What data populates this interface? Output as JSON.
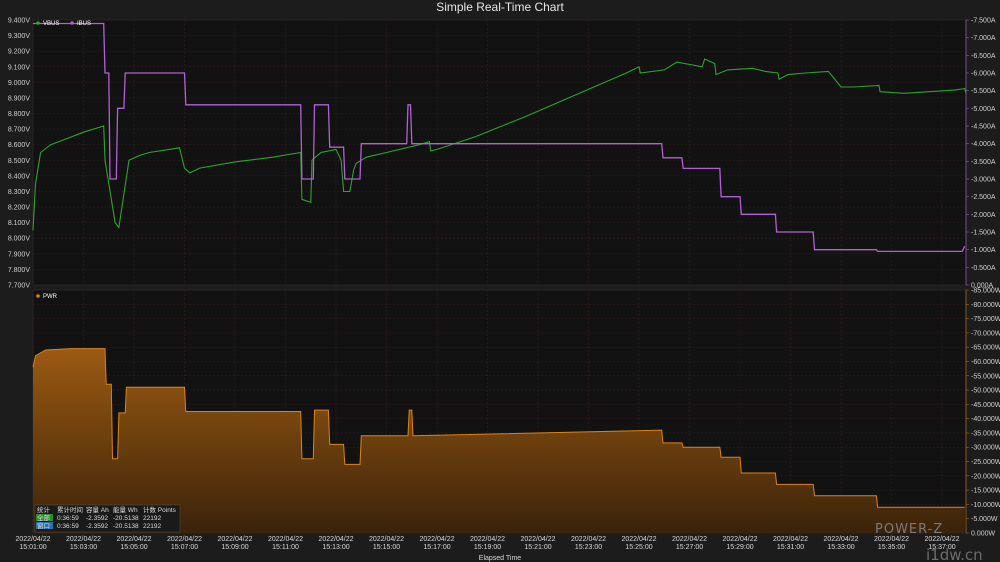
{
  "title": "Simple Real-Time Chart",
  "watermark": "POWER-Z",
  "corner_text": "i1dw.cn",
  "xlabel": "Elapsed Time",
  "x_ticks": [
    [
      "2022/04/22",
      "15:01:00"
    ],
    [
      "2022/04/22",
      "15:03:00"
    ],
    [
      "2022/04/22",
      "15:05:00"
    ],
    [
      "2022/04/22",
      "15:07:00"
    ],
    [
      "2022/04/22",
      "15:09:00"
    ],
    [
      "2022/04/22",
      "15:11:00"
    ],
    [
      "2022/04/22",
      "15:13:00"
    ],
    [
      "2022/04/22",
      "15:15:00"
    ],
    [
      "2022/04/22",
      "15:17:00"
    ],
    [
      "2022/04/22",
      "15:19:00"
    ],
    [
      "2022/04/22",
      "15:21:00"
    ],
    [
      "2022/04/22",
      "15:23:00"
    ],
    [
      "2022/04/22",
      "15:25:00"
    ],
    [
      "2022/04/22",
      "15:27:00"
    ],
    [
      "2022/04/22",
      "15:29:00"
    ],
    [
      "2022/04/22",
      "15:31:00"
    ],
    [
      "2022/04/22",
      "15:33:00"
    ],
    [
      "2022/04/22",
      "15:35:00"
    ],
    [
      "2022/04/22",
      "15:37:00"
    ]
  ],
  "stats_table": {
    "headers": [
      "统计",
      "累计时间",
      "容量 Ah",
      "能量 Wh",
      "计数 Points"
    ],
    "rows": [
      [
        "全部",
        "0:36:59",
        "-2.3592",
        "-20.5138",
        "22192"
      ],
      [
        "窗口",
        "0:36:59",
        "-2.3592",
        "-20.5138",
        "22192"
      ]
    ],
    "row_label_colors": [
      "#2e8b2e",
      "#2f6fb0"
    ]
  },
  "colors": {
    "vbus": "#2ea32e",
    "ibus": "#b25fd8",
    "pwr_line": "#d98418",
    "pwr_fill_top": "#9c5a12",
    "pwr_fill_bottom": "#3a230a",
    "plot_bg": "#121212",
    "grid": "#3a1e1e"
  },
  "chart_data": [
    {
      "type": "line",
      "title": "Simple Real-Time Chart",
      "xlabel": "Elapsed Time",
      "x_unit": "minutes since 15:01:00",
      "ylim_left": [
        7.7,
        9.4
      ],
      "ylim_right": [
        0.0,
        7.5
      ],
      "y_ticks_left": [
        "9.400V",
        "9.300V",
        "9.200V",
        "9.100V",
        "9.000V",
        "8.900V",
        "8.800V",
        "8.700V",
        "8.600V",
        "8.500V",
        "8.400V",
        "8.300V",
        "8.200V",
        "8.100V",
        "8.000V",
        "7.900V",
        "7.800V",
        "7.700V"
      ],
      "y_ticks_right": [
        "-7.500A",
        "-7.000A",
        "-6.500A",
        "-6.000A",
        "-5.500A",
        "-5.000A",
        "-4.500A",
        "-4.000A",
        "-3.500A",
        "-3.000A",
        "-2.500A",
        "-2.000A",
        "-1.500A",
        "-1.000A",
        "-0.500A",
        "0.000A"
      ],
      "legend_position": "top-left",
      "grid": true,
      "series": [
        {
          "name": "VBUS",
          "axis": "left",
          "x": [
            0,
            0.1,
            0.3,
            0.7,
            1.2,
            2,
            2.8,
            2.85,
            3.0,
            3.25,
            3.4,
            3.8,
            4.2,
            4.6,
            5,
            5.4,
            5.8,
            6,
            6.2,
            6.35,
            6.6,
            8,
            9.5,
            10.6,
            10.65,
            11.0,
            11.05,
            11.4,
            12.0,
            12.2,
            12.3,
            12.55,
            12.7,
            12.8,
            13.2,
            14.0,
            15.3,
            15.7,
            15.75,
            16.0,
            17.5,
            19.5,
            21.5,
            23.5,
            24.0,
            24.05,
            25.0,
            25.5,
            26.5,
            26.6,
            27.0,
            27.05,
            27.5,
            28.5,
            29.0,
            29.5,
            29.55,
            29.9,
            30.6,
            31.5,
            32.0,
            32.5,
            33.5,
            33.55,
            34.5,
            35.5,
            36.5,
            36.9,
            36.95
          ],
          "y": [
            8.05,
            8.35,
            8.55,
            8.6,
            8.63,
            8.68,
            8.72,
            8.5,
            8.35,
            8.1,
            8.07,
            8.5,
            8.53,
            8.55,
            8.56,
            8.57,
            8.58,
            8.45,
            8.42,
            8.43,
            8.45,
            8.49,
            8.52,
            8.55,
            8.25,
            8.23,
            8.5,
            8.55,
            8.57,
            8.5,
            8.3,
            8.3,
            8.44,
            8.48,
            8.52,
            8.55,
            8.6,
            8.62,
            8.56,
            8.57,
            8.65,
            8.78,
            8.92,
            9.06,
            9.1,
            9.06,
            9.08,
            9.13,
            9.1,
            9.15,
            9.12,
            9.05,
            9.08,
            9.09,
            9.07,
            9.06,
            9.02,
            9.05,
            9.06,
            9.07,
            8.97,
            8.97,
            8.98,
            8.94,
            8.93,
            8.94,
            8.95,
            8.96,
            8.93
          ]
        },
        {
          "name": "IBUS",
          "axis": "right",
          "x": [
            0,
            2.8,
            2.85,
            3.0,
            3.05,
            3.3,
            3.35,
            3.6,
            3.65,
            6.0,
            6.05,
            10.6,
            10.65,
            11.1,
            11.15,
            11.7,
            11.75,
            12.3,
            12.35,
            12.95,
            13.0,
            14.8,
            14.85,
            14.95,
            15.0,
            24.9,
            24.95,
            25.7,
            25.75,
            27.2,
            27.25,
            28.0,
            28.05,
            29.4,
            29.45,
            30.9,
            30.95,
            33.4,
            33.45,
            36.8,
            36.9
          ],
          "y": [
            7.4,
            7.4,
            6.0,
            6.0,
            3.0,
            3.0,
            5.0,
            5.0,
            6.0,
            6.0,
            5.1,
            5.1,
            3.0,
            3.0,
            5.1,
            5.1,
            3.9,
            3.9,
            3.0,
            3.0,
            4.0,
            4.0,
            5.1,
            5.1,
            4.0,
            4.0,
            3.6,
            3.6,
            3.3,
            3.3,
            2.5,
            2.5,
            2.0,
            2.0,
            1.5,
            1.5,
            1.0,
            1.0,
            0.95,
            0.95,
            1.1
          ]
        }
      ]
    },
    {
      "type": "area",
      "xlabel": "Elapsed Time",
      "x_unit": "minutes since 15:01:00",
      "ylim_right": [
        0,
        85
      ],
      "y_ticks_right": [
        "-85.000W",
        "-80.000W",
        "-75.000W",
        "-70.000W",
        "-65.000W",
        "-60.000W",
        "-55.000W",
        "-50.000W",
        "-45.000W",
        "-40.000W",
        "-35.000W",
        "-30.000W",
        "-25.000W",
        "-20.000W",
        "-15.000W",
        "-10.000W",
        "-5.000W",
        "0.000W"
      ],
      "legend_position": "top-left",
      "grid": true,
      "series": [
        {
          "name": "PWR",
          "axis": "right",
          "x": [
            0,
            0.1,
            0.5,
            1.5,
            2.85,
            2.9,
            3.1,
            3.15,
            3.35,
            3.4,
            3.65,
            3.7,
            6.0,
            6.05,
            10.6,
            10.65,
            11.1,
            11.15,
            11.7,
            11.75,
            12.3,
            12.35,
            12.95,
            13.0,
            14.85,
            14.9,
            15.0,
            15.05,
            24.9,
            24.95,
            25.7,
            25.75,
            27.2,
            27.25,
            28.0,
            28.05,
            29.4,
            29.45,
            30.9,
            30.95,
            33.4,
            33.45,
            36.9
          ],
          "y": [
            58,
            62,
            64,
            64.5,
            64.5,
            52,
            52,
            26,
            26,
            42,
            42,
            51,
            51,
            42.5,
            42.5,
            26,
            26,
            43,
            43,
            31,
            31,
            24,
            24,
            34,
            34,
            43,
            43,
            34,
            36,
            31.5,
            31.5,
            30,
            30,
            26.5,
            26.5,
            21,
            21,
            17,
            17,
            13,
            13,
            9,
            9
          ]
        }
      ]
    }
  ]
}
